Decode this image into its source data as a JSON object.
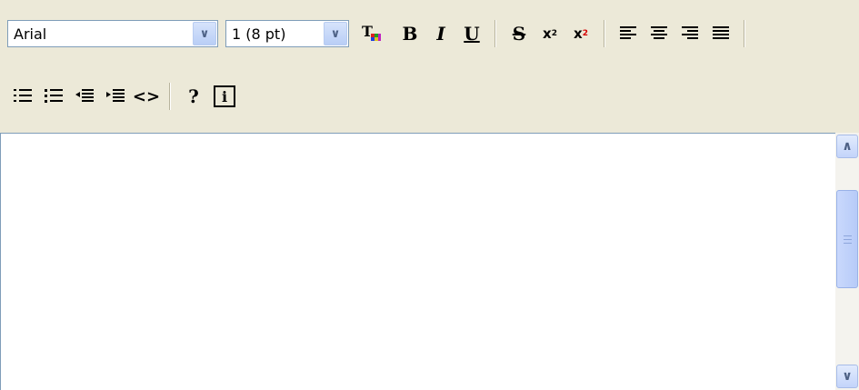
{
  "toolbar": {
    "font_select": {
      "value": "Arial"
    },
    "size_select": {
      "value": "1 (8 pt)"
    },
    "bold_label": "B",
    "italic_label": "I",
    "underline_label": "U",
    "strike_label": "S",
    "subscript_label": "x",
    "subscript_mark": "2",
    "superscript_label": "x",
    "superscript_mark": "2",
    "source_label": "<>",
    "help_label": "?",
    "info_label": "i"
  },
  "icons": {
    "text_color": "text-color-icon",
    "align_left": "align-left-icon",
    "align_center": "align-center-icon",
    "align_right": "align-right-icon",
    "align_justify": "align-justify-icon",
    "ordered_list": "ordered-list-icon",
    "unordered_list": "unordered-list-icon",
    "outdent": "outdent-icon",
    "indent": "indent-icon"
  },
  "colors": {
    "toolbar_bg": "#ECE9D8",
    "editor_bg": "#FFFFFF",
    "border": "#7F9DB9",
    "scroll_accent": "#C3D4FA",
    "superscript_red": "#D40000"
  }
}
